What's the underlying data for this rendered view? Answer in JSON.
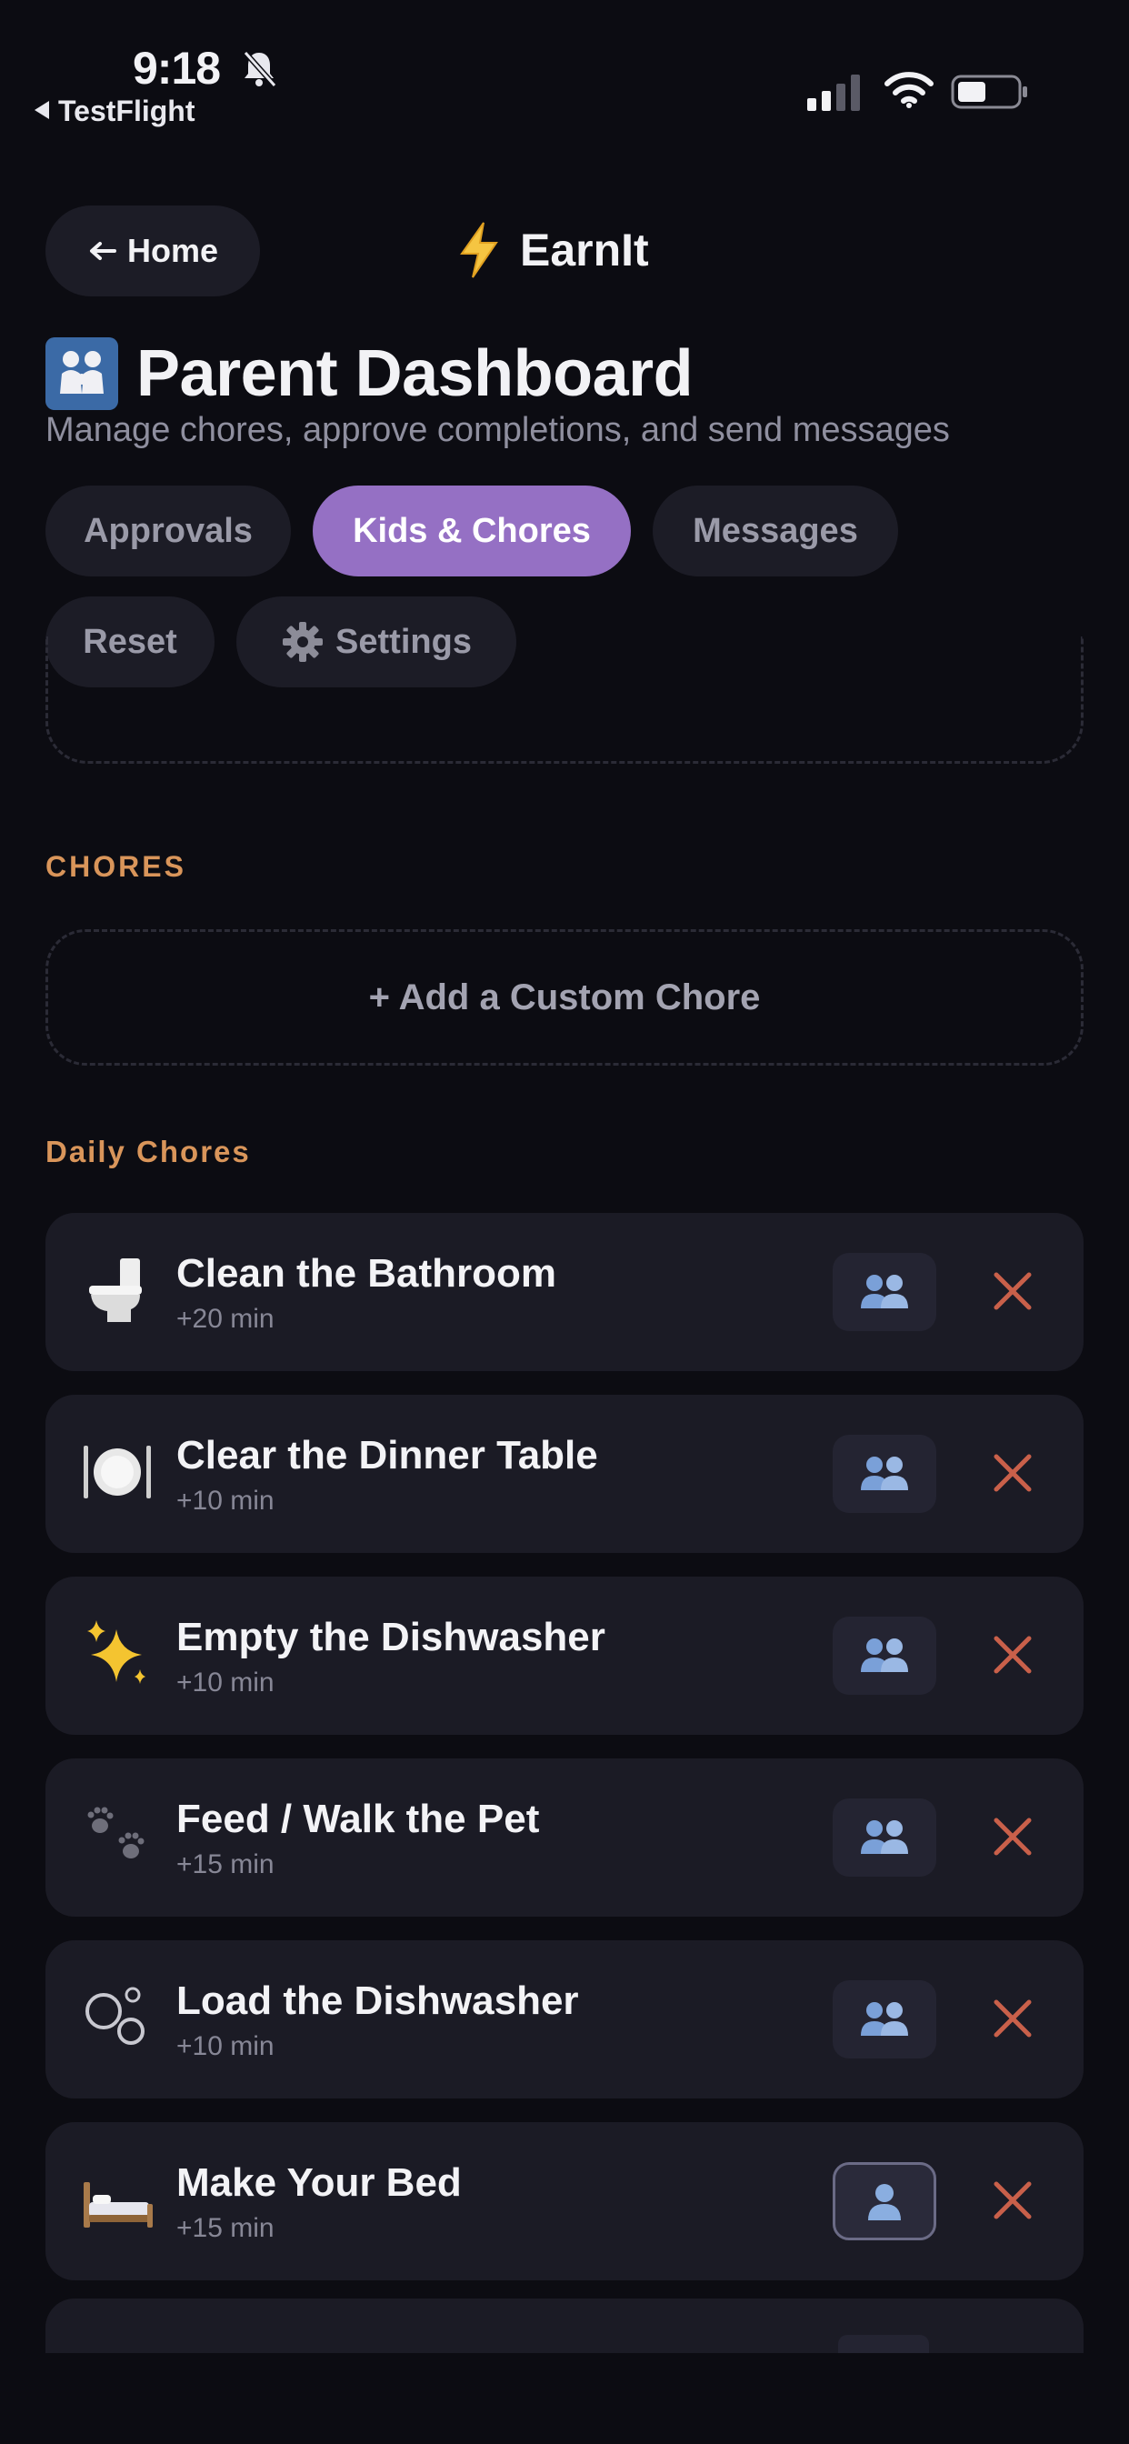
{
  "status_bar": {
    "time": "9:18",
    "back_app": "TestFlight"
  },
  "header": {
    "home_label": "Home",
    "brand": "EarnIt"
  },
  "page": {
    "title": "Parent Dashboard",
    "subtitle": "Manage chores, approve completions, and send messages"
  },
  "tabs": [
    {
      "label": "Approvals",
      "active": false
    },
    {
      "label": "Kids & Chores",
      "active": true
    },
    {
      "label": "Messages",
      "active": false
    },
    {
      "label": "Reset",
      "active": false
    },
    {
      "label": "Settings",
      "active": false
    }
  ],
  "chores_section": {
    "heading": "CHORES",
    "add_label": "+ Add a Custom Chore",
    "daily_heading": "Daily Chores"
  },
  "chores": [
    {
      "name": "Clean the Bathroom",
      "minutes": "+20 min",
      "icon": "toilet-icon",
      "assign_icon": "two-people-icon"
    },
    {
      "name": "Clear the Dinner Table",
      "minutes": "+10 min",
      "icon": "plate-icon",
      "assign_icon": "two-people-icon"
    },
    {
      "name": "Empty the Dishwasher",
      "minutes": "+10 min",
      "icon": "sparkles-icon",
      "assign_icon": "two-people-icon"
    },
    {
      "name": "Feed / Walk the Pet",
      "minutes": "+15 min",
      "icon": "paw-prints-icon",
      "assign_icon": "two-people-icon"
    },
    {
      "name": "Load the Dishwasher",
      "minutes": "+10 min",
      "icon": "bubbles-icon",
      "assign_icon": "two-people-icon"
    },
    {
      "name": "Make Your Bed",
      "minutes": "+15 min",
      "icon": "bed-icon",
      "assign_icon": "single-person-icon"
    }
  ],
  "colors": {
    "background": "#0c0c12",
    "card": "#1b1b25",
    "accent_purple": "#9570c4",
    "section_orange": "#d9955a",
    "delete_red": "#c9604a"
  }
}
